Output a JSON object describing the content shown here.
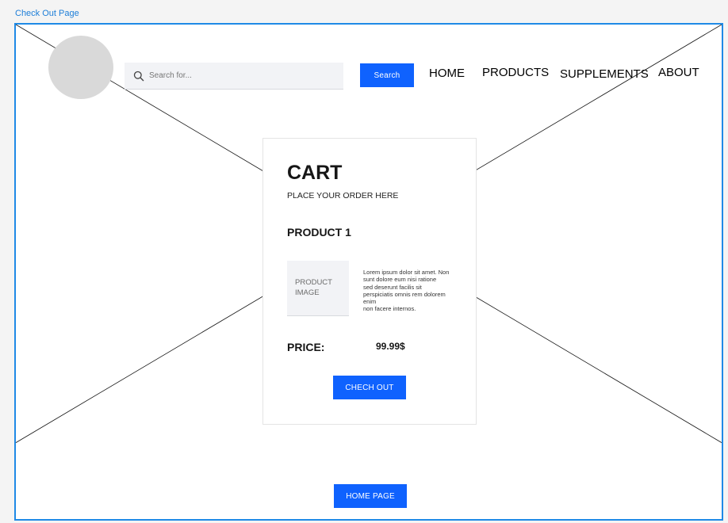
{
  "frame": {
    "label": "Check Out Page"
  },
  "header": {
    "search": {
      "placeholder": "Search for...",
      "value": ""
    },
    "search_button": "Search",
    "nav": [
      "HOME",
      "PRODUCTS",
      "SUPPLEMENTS",
      "ABOUT"
    ]
  },
  "cart": {
    "title": "CART",
    "subtitle": "PLACE YOUR ORDER HERE",
    "product_name": "PRODUCT 1",
    "product_image_line1": "PRODUCT",
    "product_image_line2": "IMAGE",
    "description": "Lorem ipsum dolor sit amet. Non\nsunt dolore eum nisi ratione\nsed deserunt facilis sit\nperspiciatis omnis rem dolorem\nenim\nnon facere internos.",
    "price_label": "PRICE:",
    "price_value": "99.99$",
    "checkout_button": "CHECH OUT"
  },
  "footer": {
    "home_button": "HOME PAGE"
  },
  "colors": {
    "accent": "#0f62fe",
    "frame_border": "#1f8ae6",
    "placeholder_gray": "#d9d9d9"
  },
  "icons": {
    "search": "search-icon"
  }
}
